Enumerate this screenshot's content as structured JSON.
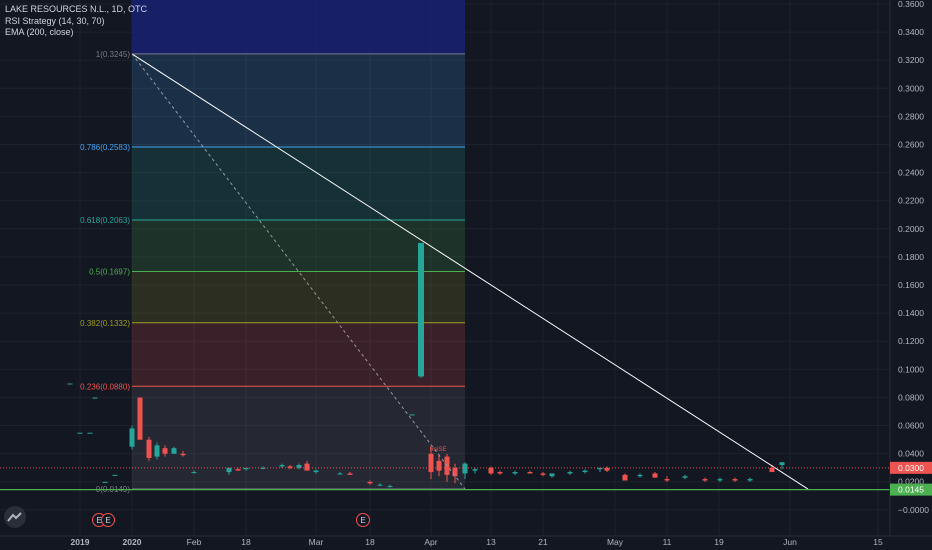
{
  "legend": {
    "symbol": "LAKE RESOURCES N.L., 1D, OTC",
    "strategy": "RSI Strategy (14, 30, 70)",
    "ema": "EMA (200, close)"
  },
  "colors": {
    "background": "#131722",
    "grid": "#1e222d",
    "up": "#26a69a",
    "down": "#ef5350",
    "last_price_line": "#ef5350",
    "support_line": "#4caf50",
    "trendline": "#ffffff",
    "axis_text": "#b2b5be"
  },
  "price_axis": {
    "labels": [
      "0.3600",
      "0.3400",
      "0.3200",
      "0.3000",
      "0.2800",
      "0.2600",
      "0.2400",
      "0.2200",
      "0.2000",
      "0.1800",
      "0.1600",
      "0.1400",
      "0.1200",
      "0.1000",
      "0.0800",
      "0.0600",
      "0.0400",
      "0.0200",
      "−0.0000"
    ],
    "last_price_tag": "0.0300",
    "support_tag": "0.0145"
  },
  "time_axis": {
    "labels": [
      "2019",
      "2020",
      "Feb",
      "18",
      "Mar",
      "18",
      "Apr",
      "13",
      "21",
      "May",
      "11",
      "19",
      "Jun",
      "15"
    ]
  },
  "fibonacci": {
    "levels": [
      {
        "label": "1(0.3245)",
        "value": 0.3245,
        "color": "#787b86"
      },
      {
        "label": "0.786(0.2583)",
        "value": 0.2583,
        "color": "#42a5f5"
      },
      {
        "label": "0.618(0.2063)",
        "value": 0.2063,
        "color": "#26a69a"
      },
      {
        "label": "0.5(0.1697)",
        "value": 0.1697,
        "color": "#4caf50"
      },
      {
        "label": "0.382(0.1332)",
        "value": 0.1332,
        "color": "#9e9d24"
      },
      {
        "label": "0.236(0.0880)",
        "value": 0.088,
        "color": "#ef5350"
      },
      {
        "label": "0(0.0149)",
        "value": 0.0149,
        "color": "#787b86"
      }
    ],
    "top_band_color": "#1a237e"
  },
  "markers": {
    "earnings": "E",
    "dividend": "E",
    "signal_label": "RsiSE"
  }
}
